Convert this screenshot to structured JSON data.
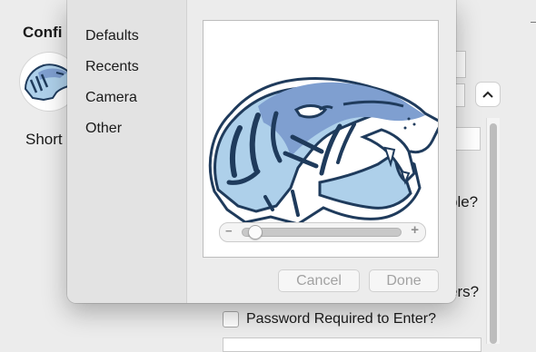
{
  "background_window": {
    "title_partial": "Confi",
    "short_partial": "Short",
    "question_1_partial": "ble?",
    "question_2_partial": "ers?",
    "password_checkbox": {
      "label": "Password Required to Enter?",
      "checked": false
    },
    "stepper_icon": "chevron-up-icon"
  },
  "picker": {
    "sidebar_items": [
      {
        "label": "Defaults"
      },
      {
        "label": "Recents"
      },
      {
        "label": "Camera"
      },
      {
        "label": "Other"
      }
    ],
    "zoom": {
      "minus": "−",
      "plus": "+",
      "level": 0.07
    },
    "buttons": {
      "cancel": "Cancel",
      "done": "Done"
    }
  },
  "colors": {
    "tiger_dark": "#1f3b5c",
    "tiger_mid": "#7f9fd0",
    "tiger_light": "#aed0ea"
  }
}
